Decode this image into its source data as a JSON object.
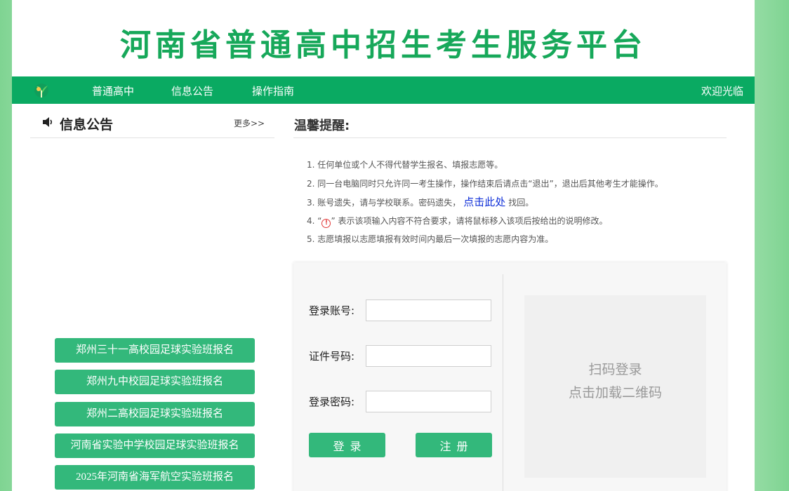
{
  "site": {
    "title": "河南省普通高中招生考生服务平台"
  },
  "nav": {
    "items": [
      "普通高中",
      "信息公告",
      "操作指南"
    ],
    "welcome": "欢迎光临"
  },
  "announcements": {
    "title": "信息公告",
    "more": "更多>>",
    "buttons": [
      "郑州三十一高校园足球实验班报名",
      "郑州九中校园足球实验班报名",
      "郑州二高校园足球实验班报名",
      "河南省实验中学校园足球实验班报名",
      "2025年河南省海军航空实验班报名"
    ]
  },
  "tips": {
    "title": "温馨提醒:",
    "items": {
      "t1": "1. 任何单位或个人不得代替学生报名、填报志愿等。",
      "t2": "2. 同一台电脑同时只允许同一考生操作，操作结束后请点击“退出”，退出后其他考生才能操作。",
      "t3_before": "3. 账号遗失，请与学校联系。密码遗失，",
      "t3_link": "点击此处",
      "t3_after": "找回。",
      "t4_before": "4. “",
      "t4_icon": "!",
      "t4_after": "” 表示该项输入内容不符合要求，请将鼠标移入该项后按给出的说明修改。",
      "t5": "5. 志愿填报以志愿填报有效时间内最后一次填报的志愿内容为准。"
    }
  },
  "login": {
    "account_label": "登录账号:",
    "id_label": "证件号码:",
    "password_label": "登录密码:",
    "login_button": "登录",
    "register_button": "注册",
    "qr_line1": "扫码登录",
    "qr_line2": "点击加载二维码"
  },
  "colors": {
    "brand_green": "#0aaa62",
    "button_green": "#33b87b",
    "link_blue": "#1030d8",
    "warn_red": "#e23a3a"
  }
}
